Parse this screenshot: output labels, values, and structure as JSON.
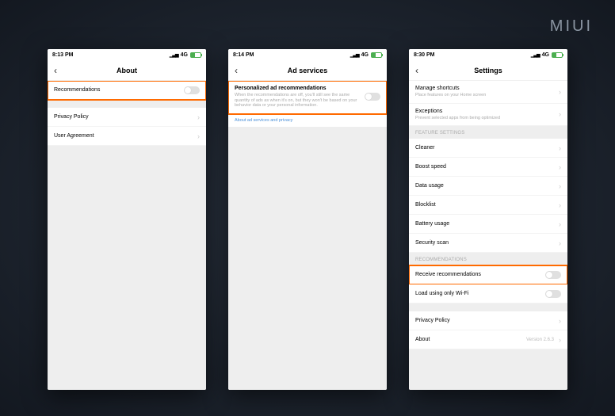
{
  "logo": "MIUI",
  "network": "4G",
  "phone1": {
    "time": "8:13 PM",
    "title": "About",
    "rows": {
      "recommendations": "Recommendations",
      "privacy": "Privacy Policy",
      "agreement": "User Agreement"
    }
  },
  "phone2": {
    "time": "8:14 PM",
    "title": "Ad services",
    "row": {
      "label": "Personalized ad recommendations",
      "sub": "When the recommendations are off, you'll still see the same quantity of ads as when it's on, but they won't be based on your behavior data or your personal information."
    },
    "link": "About ad services and privacy"
  },
  "phone3": {
    "time": "8:30 PM",
    "title": "Settings",
    "shortcuts": {
      "label": "Manage shortcuts",
      "sub": "Place features on your Home screen"
    },
    "exceptions": {
      "label": "Exceptions",
      "sub": "Prevent selected apps from being optimized"
    },
    "section1": "FEATURE SETTINGS",
    "cleaner": "Cleaner",
    "boost": "Boost speed",
    "datausage": "Data usage",
    "blocklist": "Blocklist",
    "battery": "Battery usage",
    "security": "Security scan",
    "section2": "RECOMMENDATIONS",
    "receive": "Receive recommendations",
    "wifi": "Load using only Wi-Fi",
    "privacy": "Privacy Policy",
    "about": {
      "label": "About",
      "value": "Version 2.6.3"
    }
  }
}
